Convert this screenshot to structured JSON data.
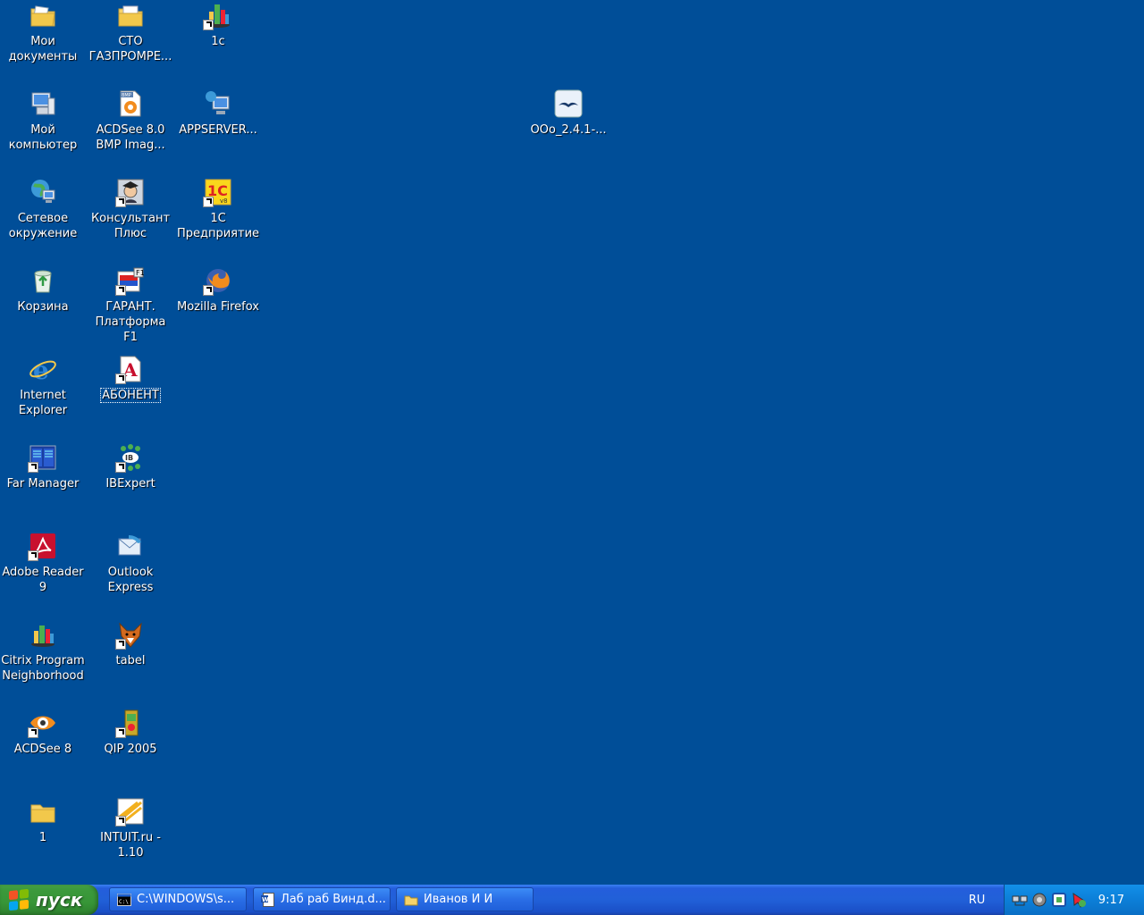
{
  "desktop": {
    "icons": [
      {
        "id": "my-documents",
        "label": "Мои\nдокументы",
        "shortcut": false
      },
      {
        "id": "sto-gazprom",
        "label": "СТО\nГАЗПРОМРЕ...",
        "shortcut": false
      },
      {
        "id": "1c-citrix",
        "label": "1с",
        "shortcut": true
      },
      {
        "id": "my-computer",
        "label": "Мой\nкомпьютер",
        "shortcut": false
      },
      {
        "id": "acdsee-bmp",
        "label": "ACDSee 8.0\nBMP Imag...",
        "shortcut": false
      },
      {
        "id": "appserver",
        "label": "APPSERVER...",
        "shortcut": false
      },
      {
        "id": "ooo",
        "label": "OOo_2.4.1-...",
        "shortcut": false
      },
      {
        "id": "network",
        "label": "Сетевое\nокружение",
        "shortcut": false
      },
      {
        "id": "consultant",
        "label": "Консультант\nПлюс",
        "shortcut": true
      },
      {
        "id": "1c-enterprise",
        "label": "1С\nПредприятие",
        "shortcut": true
      },
      {
        "id": "recycle-bin",
        "label": "Корзина",
        "shortcut": false
      },
      {
        "id": "garant",
        "label": "ГАРАНТ.\nПлатформа F1",
        "shortcut": true
      },
      {
        "id": "firefox",
        "label": "Mozilla Firefox",
        "shortcut": true
      },
      {
        "id": "ie",
        "label": "Internet\nExplorer",
        "shortcut": false
      },
      {
        "id": "abonent",
        "label": "АБОНЕНТ",
        "shortcut": true
      },
      {
        "id": "far",
        "label": "Far Manager",
        "shortcut": true
      },
      {
        "id": "ibexpert",
        "label": "IBExpert",
        "shortcut": true
      },
      {
        "id": "adobe",
        "label": "Adobe Reader\n9",
        "shortcut": true
      },
      {
        "id": "outlook",
        "label": "Outlook\nExpress",
        "shortcut": false
      },
      {
        "id": "citrix",
        "label": "Citrix Program\nNeighborhood",
        "shortcut": false
      },
      {
        "id": "tabel",
        "label": "tabel",
        "shortcut": true
      },
      {
        "id": "acdsee8",
        "label": "ACDSee 8",
        "shortcut": true
      },
      {
        "id": "qip",
        "label": "QIP 2005",
        "shortcut": true
      },
      {
        "id": "folder-1",
        "label": "1",
        "shortcut": false
      },
      {
        "id": "intuit",
        "label": "INTUIT.ru -\n1.10",
        "shortcut": true
      }
    ]
  },
  "taskbar": {
    "start_label": "пуск",
    "tasks": [
      {
        "label": "C:\\WINDOWS\\s...",
        "icon": "console-icon"
      },
      {
        "label": "Лаб раб Винд.d...",
        "icon": "word-document-icon"
      },
      {
        "label": "Иванов И И",
        "icon": "folder-icon"
      }
    ],
    "language": "RU",
    "clock": "9:17"
  },
  "colors": {
    "desktop": "#004E98",
    "start": "#3C9A3C",
    "taskbar": "#245EDC",
    "tray": "#0C7FD8"
  }
}
